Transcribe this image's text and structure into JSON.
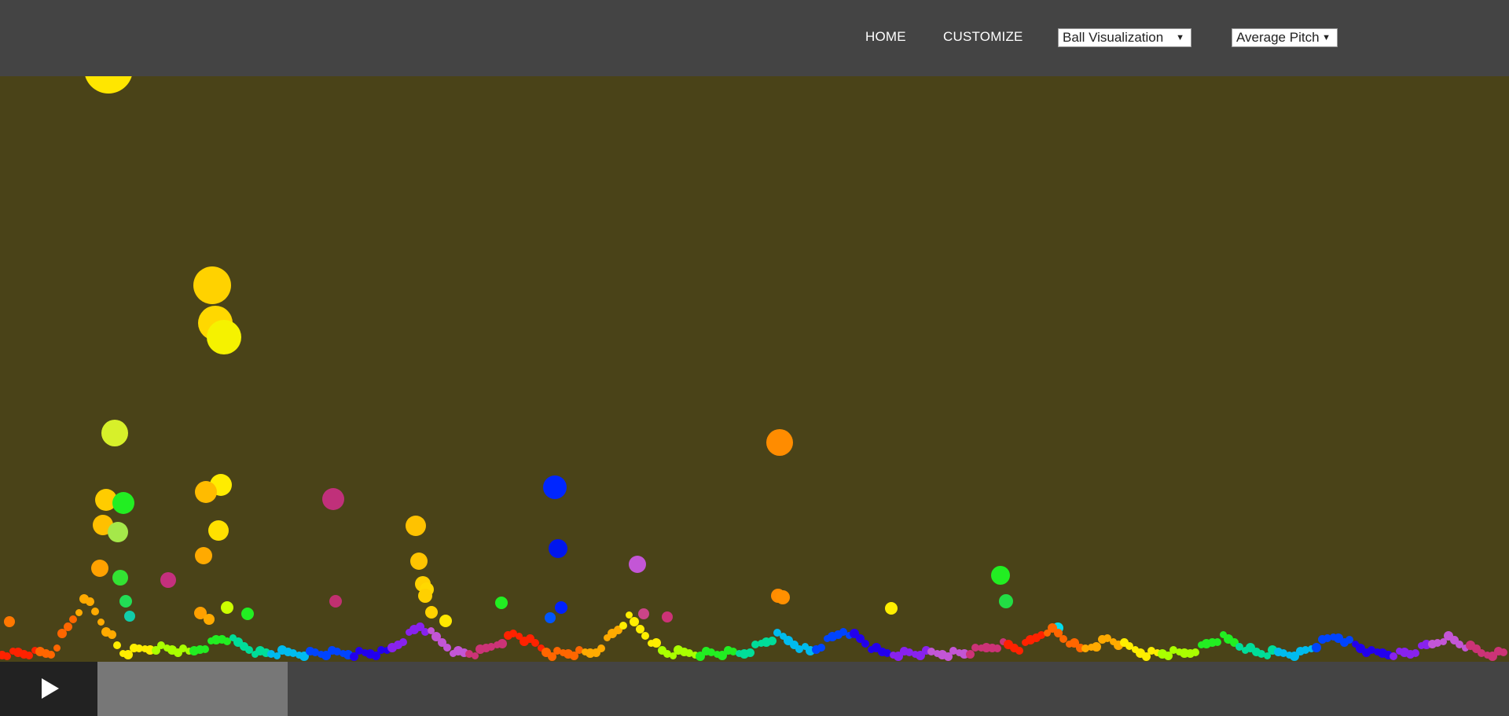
{
  "nav": {
    "home_label": "HOME",
    "customize_label": "CUSTOMIZE",
    "visualization_select": {
      "selected": "Ball Visualization"
    },
    "metric_select": {
      "selected": "Average Pitch"
    }
  },
  "colors": {
    "background": "#4a4318",
    "bars": "#444444",
    "play_button": "#222222",
    "progress_fill": "#777777"
  },
  "player": {
    "play_icon": "play-icon",
    "progress": 0.135
  }
}
